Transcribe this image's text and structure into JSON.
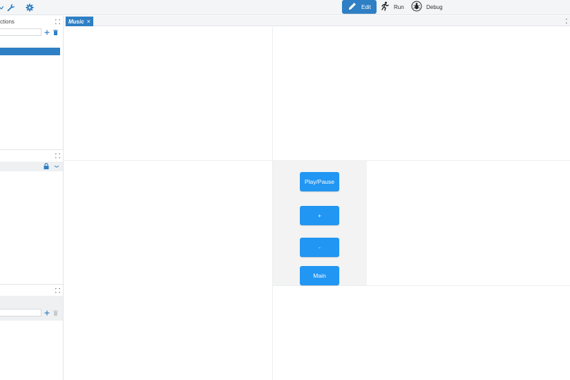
{
  "toolbar": {
    "modes": [
      {
        "label": "Edit",
        "icon": "pencil-icon",
        "active": true
      },
      {
        "label": "Run",
        "icon": "running-person-icon",
        "active": false
      },
      {
        "label": "Debug",
        "icon": "bug-icon",
        "active": false
      }
    ],
    "left_icons": [
      "chevron-icon",
      "wrench-icon",
      "gear-icon"
    ]
  },
  "left_panel": {
    "sections_title": "ctions"
  },
  "editor": {
    "tab_label": "Music",
    "tab_close": "×"
  },
  "app_preview": {
    "buttons": [
      "Play/Pause",
      "+",
      "-",
      "Main"
    ]
  },
  "colors": {
    "accent": "#2f7fc4",
    "app_button": "#2196f3"
  }
}
